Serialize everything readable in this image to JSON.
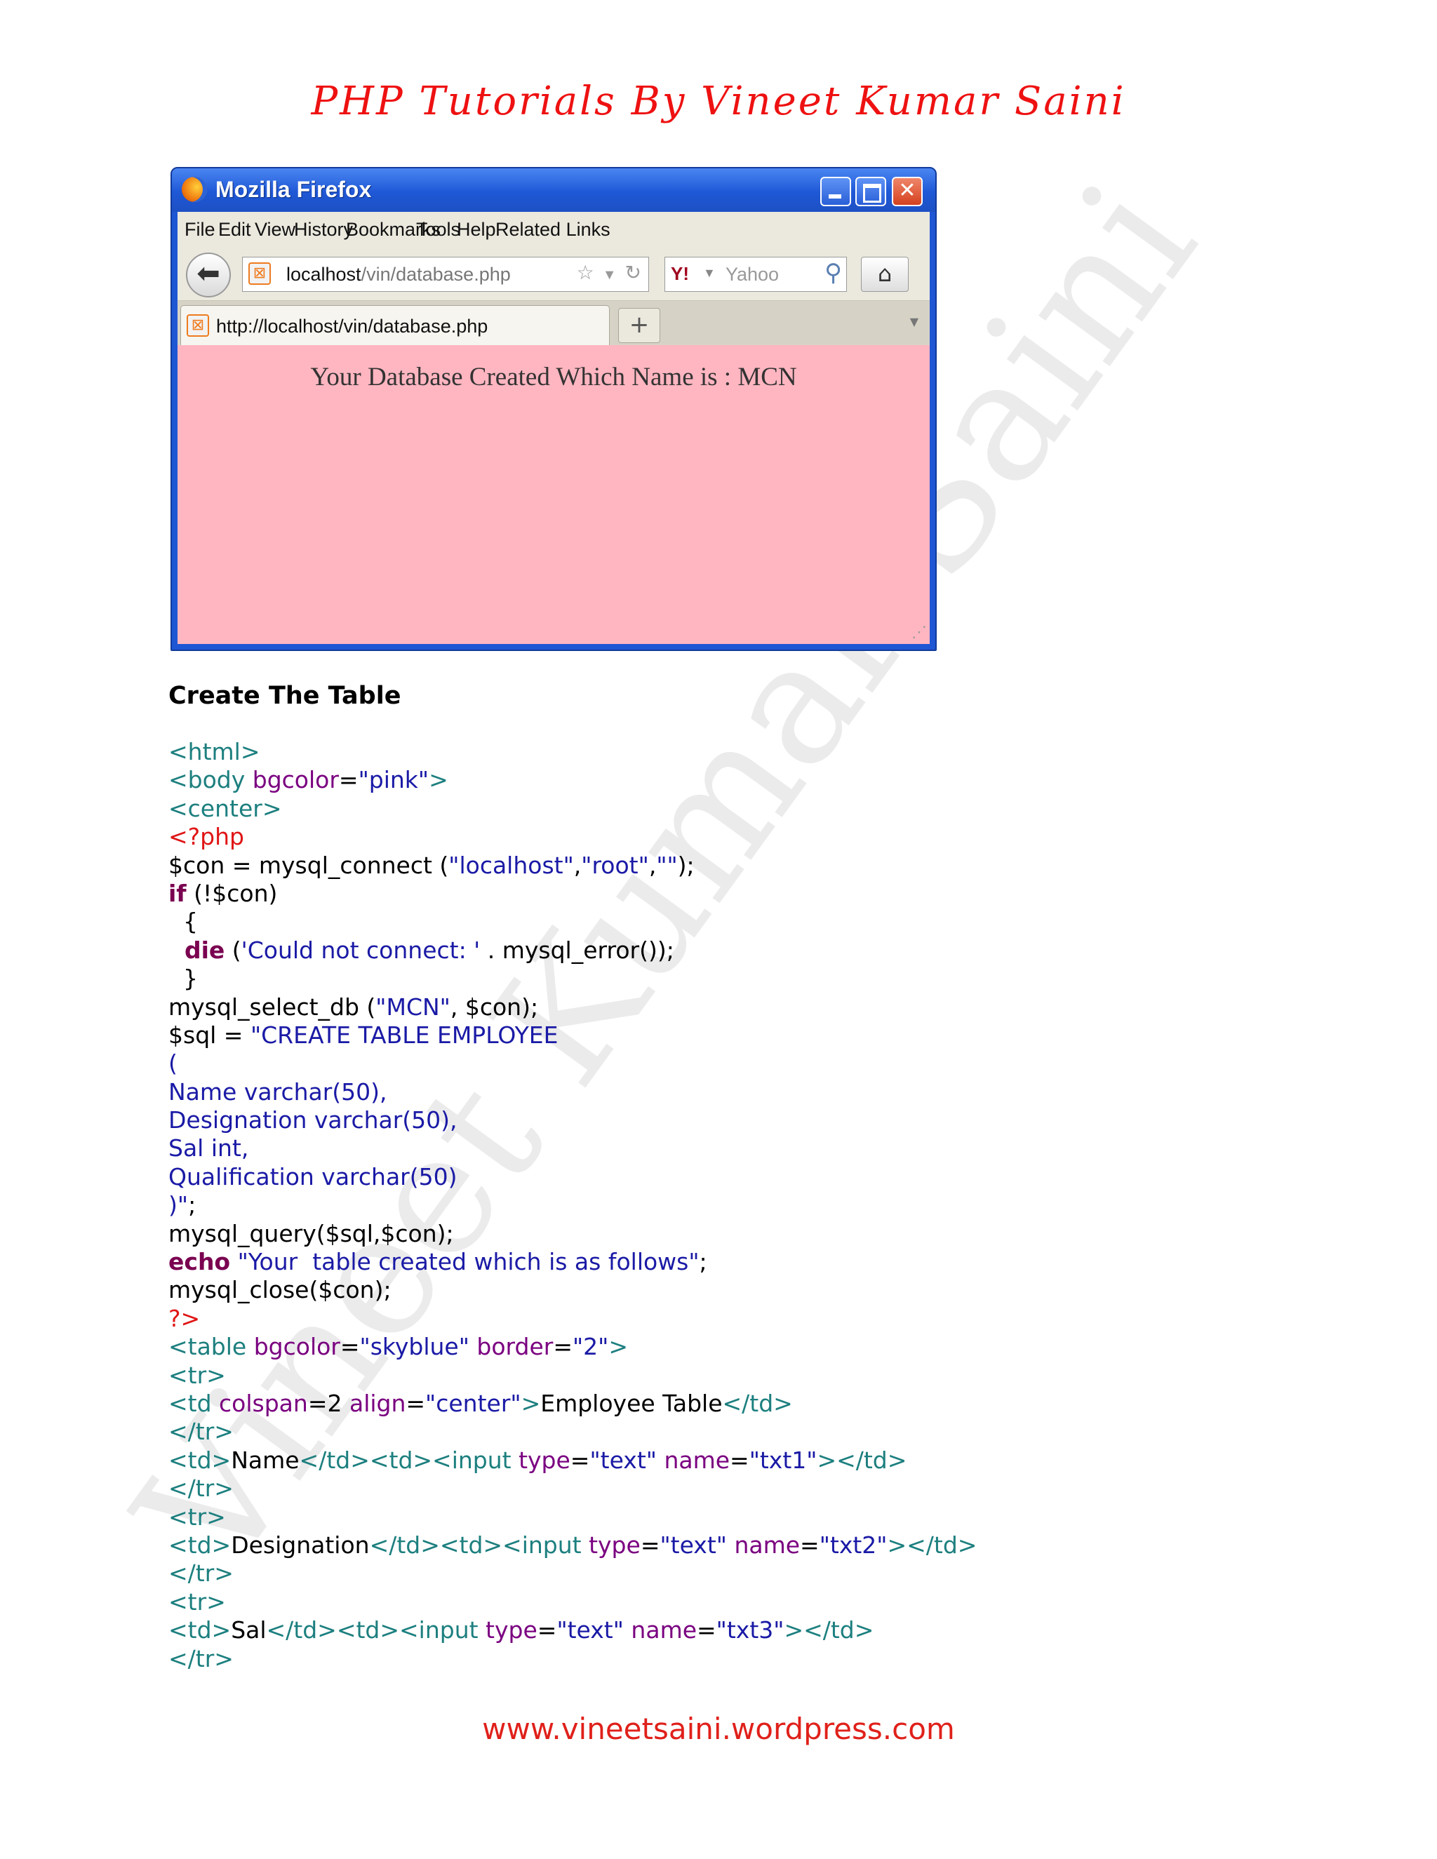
{
  "header": {
    "title": "PHP  Tutorials By Vineet Kumar Saini"
  },
  "watermark": {
    "text": "Vineet Kumar Saini"
  },
  "browser": {
    "title": "Mozilla Firefox",
    "menu": [
      "File",
      "Edit",
      "View",
      "History",
      "Bookmarks",
      "Tools",
      "Help",
      "Related Links"
    ],
    "url": {
      "host": "localhost",
      "path": "/vin/database.php"
    },
    "search_placeholder": "Yahoo",
    "tab_title": "http://localhost/vin/database.php",
    "content_message": "Your Database Created Which Name is : MCN",
    "colors": {
      "content_bg": "#ffb6c1",
      "title_bar": "#1f56d4"
    }
  },
  "section": {
    "title": "Create The Table"
  },
  "code": {
    "l1": {
      "a": "<html>"
    },
    "l2": {
      "a": "<body",
      "b": " bgcolor",
      "c": "=",
      "d": "\"pink\"",
      "e": ">"
    },
    "l3": {
      "a": "<center>"
    },
    "l4": {
      "a": "<?php"
    },
    "l5": {
      "a": "$con = mysql_connect (",
      "b": "\"localhost\"",
      "c": ",",
      "d": "\"root\"",
      "e": ",",
      "f": "\"\"",
      "g": ");"
    },
    "l6": {
      "a": "if",
      "b": " (!$con)"
    },
    "l7": {
      "a": "  {"
    },
    "l8": {
      "a": "  die",
      "b": " (",
      "c": "'Could not connect: '",
      "d": " . mysql_error());"
    },
    "l9": {
      "a": "  }"
    },
    "l10": {
      "a": "mysql_select_db (",
      "b": "\"MCN\"",
      "c": ", $con);"
    },
    "l11": {
      "a": "$sql = ",
      "b": "\"CREATE TABLE EMPLOYEE"
    },
    "l12": {
      "a": "("
    },
    "l13": {
      "a": "Name varchar(50),"
    },
    "l14": {
      "a": "Designation varchar(50),"
    },
    "l15": {
      "a": "Sal int,"
    },
    "l16": {
      "a": "Qualification varchar(50)"
    },
    "l17": {
      "a": ")\"",
      "b": ";"
    },
    "l18": {
      "a": "mysql_query($sql,$con);"
    },
    "l19": {
      "a": "echo",
      "b": " \"Your  table created which is as follows\"",
      "c": ";"
    },
    "l20": {
      "a": "mysql_close($con);"
    },
    "l21": {
      "a": "?>"
    },
    "l22": {
      "a": "<table",
      "b": " bgcolor",
      "c": "=",
      "d": "\"skyblue\"",
      "e": " border",
      "f": "=",
      "g": "\"2\"",
      "h": ">"
    },
    "l23": {
      "a": "<tr>"
    },
    "l24": {
      "a": "<td",
      "b": " colspan",
      "c": "=2 ",
      "d": "align",
      "e": "=",
      "f": "\"center\"",
      "g": ">",
      "h": "Employee Table",
      "i": "</td>"
    },
    "l25": {
      "a": "</tr>"
    },
    "l26": {
      "a": "<td>",
      "b": "Name",
      "c": "</td><td><input",
      "d": " type",
      "e": "=",
      "f": "\"text\"",
      "g": " name",
      "h": "=",
      "i": "\"txt1\"",
      "j": "></td>"
    },
    "l27": {
      "a": "</tr>"
    },
    "l28": {
      "a": "<tr>"
    },
    "l29": {
      "a": "<td>",
      "b": "Designation",
      "c": "</td><td><input",
      "d": " type",
      "e": "=",
      "f": "\"text\"",
      "g": " name",
      "h": "=",
      "i": "\"txt2\"",
      "j": "></td>"
    },
    "l30": {
      "a": "</tr>"
    },
    "l31": {
      "a": "<tr>"
    },
    "l32": {
      "a": "<td>",
      "b": "Sal",
      "c": "</td><td><input",
      "d": " type",
      "e": "=",
      "f": "\"text\"",
      "g": " name",
      "h": "=",
      "i": "\"txt3\"",
      "j": "></td>"
    },
    "l33": {
      "a": "</tr>"
    }
  },
  "footer": {
    "text": "www.vineetsaini.wordpress.com"
  }
}
